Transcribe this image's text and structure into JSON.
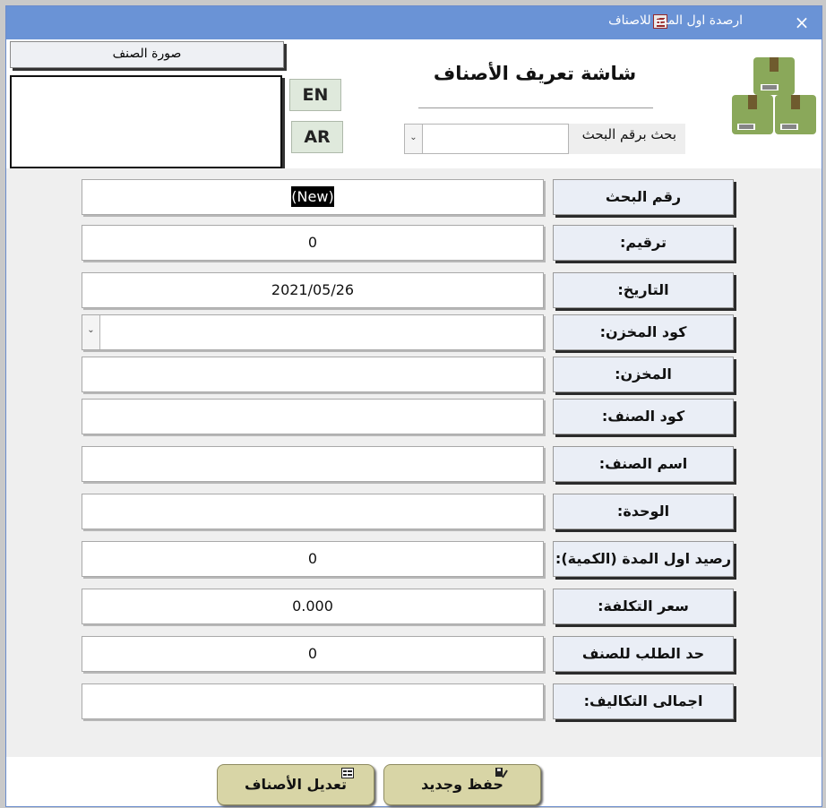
{
  "window": {
    "title": "ارصدة اول المدة للاصناف",
    "close_icon": "×"
  },
  "header": {
    "image_label": "صورة الصنف",
    "lang_en": "EN",
    "lang_ar": "AR",
    "form_title": "شاشة تعريف الأصناف",
    "search_label": "بحث برقم البحث",
    "search_value": ""
  },
  "fields": [
    {
      "label": "رقم البحث",
      "value": "(New)"
    },
    {
      "label": "ترقيم:",
      "value": "0"
    },
    {
      "label": "التاريخ:",
      "value": "2021/05/26"
    },
    {
      "label": "كود المخزن:",
      "value": ""
    },
    {
      "label": "المخزن:",
      "value": ""
    },
    {
      "label": "كود الصنف:",
      "value": ""
    },
    {
      "label": "اسم الصنف:",
      "value": ""
    },
    {
      "label": "الوحدة:",
      "value": ""
    },
    {
      "label": "رصيد اول المدة (الكمية):",
      "value": "0"
    },
    {
      "label": "سعر التكلفة:",
      "value": "0.000"
    },
    {
      "label": "حد الطلب للصنف",
      "value": "0"
    },
    {
      "label": "اجمالى التكاليف:",
      "value": ""
    }
  ],
  "footer": {
    "save_new_label": "حفظ وجديد",
    "edit_items_label": "تعديل الأصناف"
  },
  "colors": {
    "titlebar": "#6a93d6",
    "label_bg": "#eaeef6",
    "button_bg": "#d8d5a6",
    "logo_box": "#8aa85a"
  }
}
